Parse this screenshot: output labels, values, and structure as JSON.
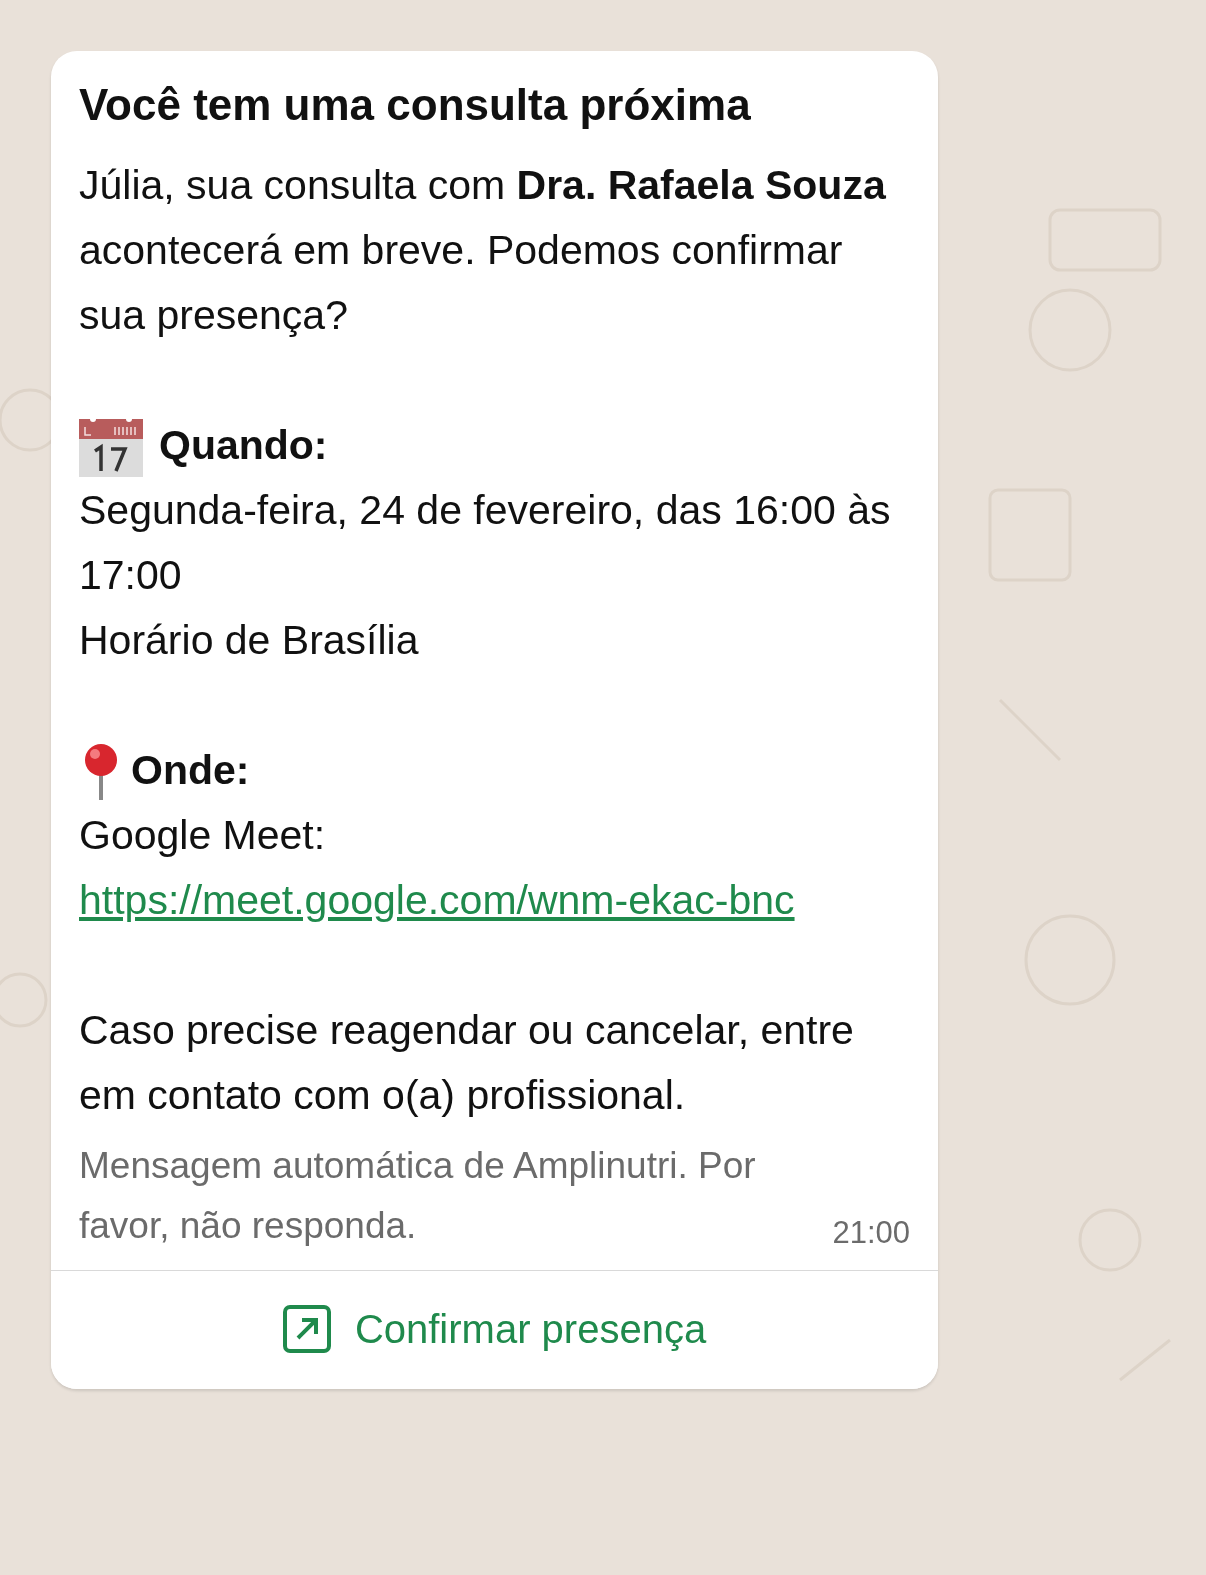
{
  "message": {
    "title": "Você tem uma consulta próxima",
    "intro": "Júlia, sua consulta com **Dra. Rafaela Souza** acontecerá em breve. Podemos confirmar sua presença?",
    "when": {
      "label": "Quando:",
      "lines": [
        "Segunda-feira, 24 de fevereiro, das 16:00 às 17:00",
        "Horário de Brasília"
      ]
    },
    "where": {
      "label": "Onde:",
      "prefix": "Google Meet:",
      "link": "https://meet.google.com/wnm-ekac-bnc"
    },
    "note": "Caso precise reagendar ou cancelar, entre em contato com o(a) profissional.",
    "footer": "Mensagem automática de Amplinutri. Por favor, não responda.",
    "time": "21:00",
    "button": "Confirmar presença"
  }
}
